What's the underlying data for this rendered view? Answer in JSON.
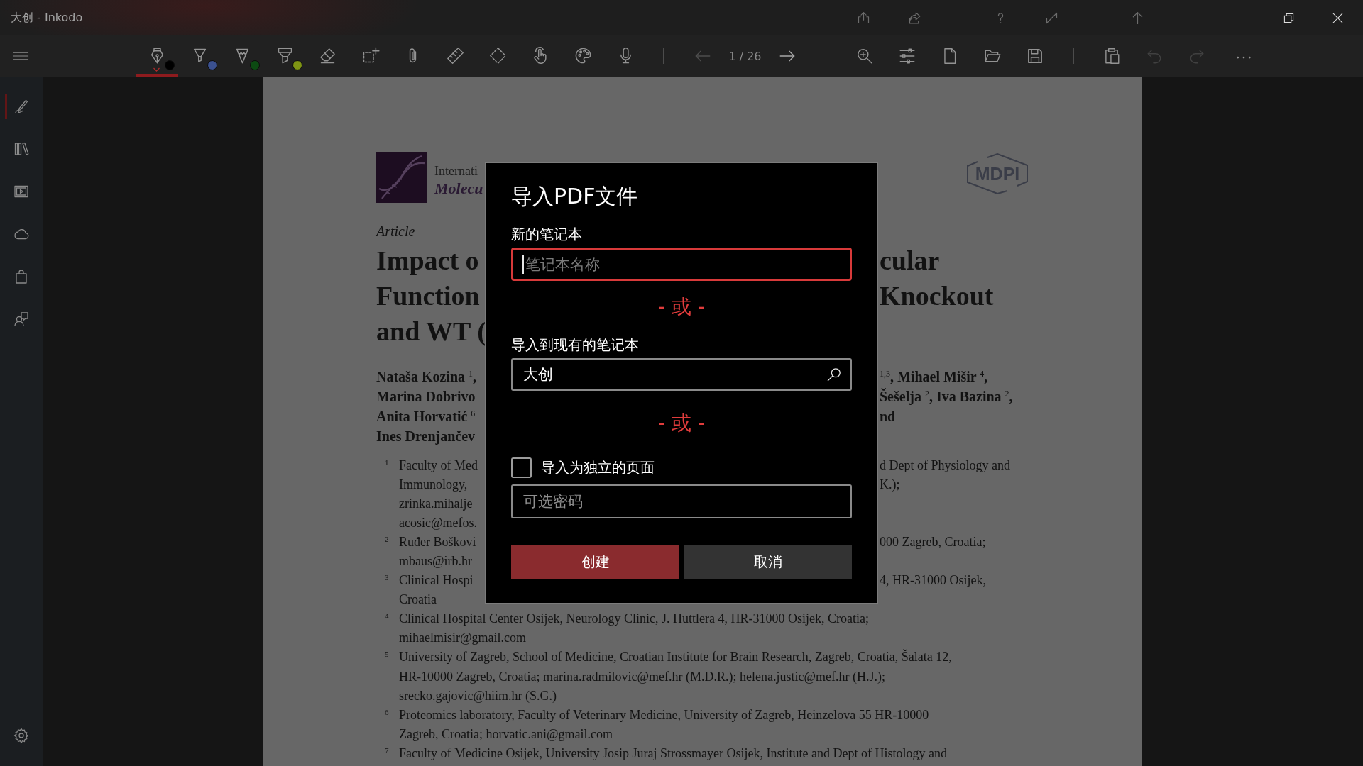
{
  "window": {
    "title": "大创 - Inkodo"
  },
  "toolbar": {
    "tools": [
      {
        "selected": true,
        "color": "#000000"
      },
      {
        "selected": false,
        "color": "#3b5190"
      },
      {
        "selected": false,
        "color": "#0c4a12"
      },
      {
        "selected": false,
        "color": "#7f9514"
      },
      {
        "selected": false
      },
      {
        "selected": false
      },
      {
        "selected": false
      },
      {
        "selected": false
      },
      {
        "selected": false
      },
      {
        "selected": false
      },
      {
        "selected": false
      },
      {
        "selected": false
      }
    ],
    "back": {
      "disabled": true
    },
    "page_counter": "1 / 26",
    "forward": {
      "disabled": false
    },
    "undo": {
      "disabled": true
    },
    "redo": {
      "disabled": true
    }
  },
  "sidebar": {
    "items": [
      {
        "selected": true
      },
      {
        "selected": false
      },
      {
        "selected": false
      },
      {
        "selected": false
      },
      {
        "selected": false
      },
      {
        "selected": false
      }
    ]
  },
  "document": {
    "journal": {
      "line_1": "Internati",
      "line_2": "Molecu"
    },
    "publisher_logo": "MDPI",
    "article_type": "Article",
    "title_lines": [
      {
        "left": "Impact o",
        "right": "cular"
      },
      {
        "left": "Function",
        "right": "Knockout"
      },
      {
        "left": "and WT ("
      }
    ],
    "authors": [
      {
        "left": "Nataša Kozina $^{1}$,",
        "right": "$^{1,3}$, Mihael Mišir $^{4}$,"
      },
      {
        "left": "Marina Dobrivo",
        "right": "Šešelja $^{2}$, Iva Bazina $^{2}$,"
      },
      {
        "left": "Anita Horvatić $^{6}$",
        "right": "nd"
      },
      {
        "left": "Ines Drenjančev"
      }
    ],
    "affiliations": [
      {
        "number": "1",
        "kind": "split",
        "lines": [
          {
            "left": "Faculty of Med",
            "right": "d Dept of Physiology and"
          },
          {
            "left": "Immunology,",
            "right": "K.);"
          },
          {
            "left": "zrinka.mihalje"
          },
          {
            "left": "acosic@mefos."
          }
        ]
      },
      {
        "number": "2",
        "kind": "split",
        "lines": [
          {
            "left": "Ruđer Boškovi",
            "right": "000 Zagreb, Croatia;"
          },
          {
            "left": "mbaus@irb.hr"
          }
        ]
      },
      {
        "number": "3",
        "kind": "split",
        "lines": [
          {
            "left": "Clinical Hospi",
            "right": "4, HR-31000 Osijek,"
          },
          {
            "left": "Croatia"
          }
        ]
      },
      {
        "number": "4",
        "kind": "whole",
        "lines": [
          "Clinical Hospital Center Osijek, Neurology Clinic, J. Huttlera 4, HR-31000 Osijek, Croatia;",
          "mihaelmisir@gmail.com"
        ]
      },
      {
        "number": "5",
        "kind": "whole",
        "lines": [
          "University of Zagreb, School of Medicine, Croatian Institute for Brain Research, Zagreb, Croatia, Šalata 12,",
          "HR-10000 Zagreb, Croatia; marina.radmilovic@mef.hr (M.D.R.); helena.justic@mef.hr (H.J.);",
          "srecko.gajovic@hiim.hr (S.G.)"
        ]
      },
      {
        "number": "6",
        "kind": "whole",
        "lines": [
          "Proteomics laboratory, Faculty of Veterinary Medicine, University of Zagreb, Heinzelova 55 HR-10000",
          "Zagreb, Croatia; horvatic.ani@gmail.com"
        ]
      },
      {
        "number": "7",
        "kind": "whole",
        "lines": [
          "Faculty of Medicine Osijek, University Josip Juraj Strossmayer Osijek, Institute and Dept of Histology and"
        ]
      }
    ]
  },
  "dialog": {
    "title": "导入PDF文件",
    "new_notebook_label": "新的笔记本",
    "name_field": {
      "placeholder": "笔记本名称",
      "focused": true
    },
    "or_divider_1": "- 或 -",
    "existing_notebook_label": "导入到现有的笔记本",
    "notebook_search": {
      "value": "大创"
    },
    "or_divider_2": "- 或 -",
    "separate_pages": {
      "label": "导入为独立的页面",
      "checked": false
    },
    "password_field": {
      "placeholder": "可选密码"
    },
    "buttons": [
      {
        "label": "创建",
        "kind": "primary"
      },
      {
        "label": "取消",
        "kind": "secondary"
      }
    ]
  }
}
